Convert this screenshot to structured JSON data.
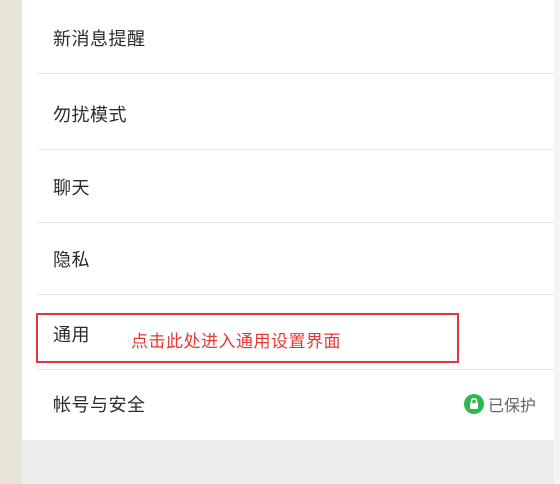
{
  "settings": {
    "items": [
      {
        "label": "新消息提醒"
      },
      {
        "label": "勿扰模式"
      },
      {
        "label": "聊天"
      },
      {
        "label": "隐私"
      },
      {
        "label": "通用"
      },
      {
        "label": "帐号与安全",
        "status": "已保护",
        "status_icon": "lock-icon",
        "status_color": "#2db84d"
      }
    ]
  },
  "annotation": {
    "text": "点击此处进入通用设置界面",
    "color": "#e53935"
  },
  "colors": {
    "sidebar": "#e9e5d6",
    "divider": "#e6e6e6",
    "footer": "#ededed",
    "highlight": "#e0353b"
  }
}
